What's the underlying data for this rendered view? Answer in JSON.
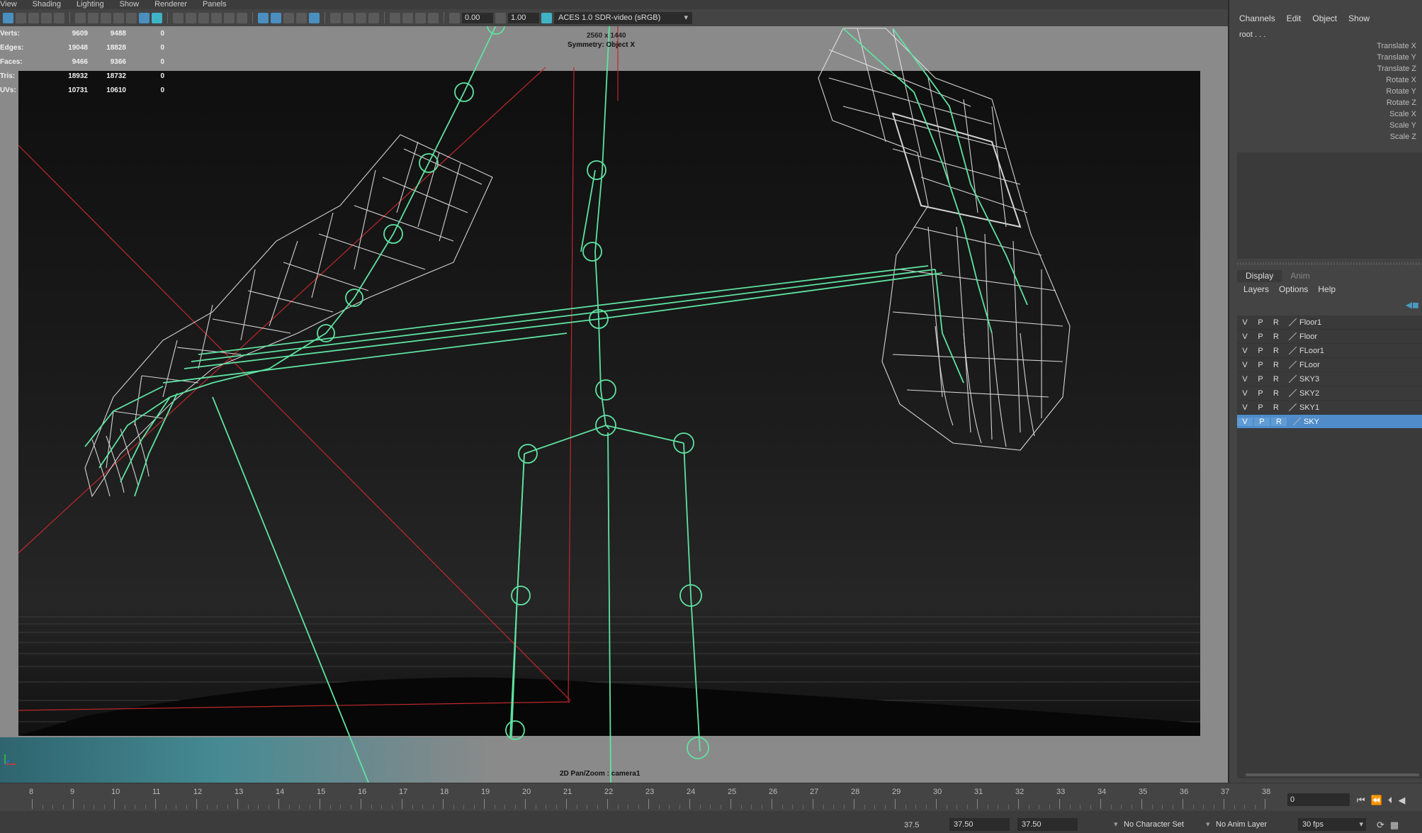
{
  "menubar": [
    "View",
    "Shading",
    "Lighting",
    "Show",
    "Renderer",
    "Panels"
  ],
  "toolbar": {
    "field_a": "0.00",
    "field_b": "1.00",
    "color_management": "ACES 1.0 SDR-video (sRGB)"
  },
  "hud": {
    "stats": [
      {
        "label": "Verts:",
        "values": [
          "9609",
          "9488",
          "0"
        ]
      },
      {
        "label": "Edges:",
        "values": [
          "19048",
          "18828",
          "0"
        ]
      },
      {
        "label": "Faces:",
        "values": [
          "9466",
          "9366",
          "0"
        ]
      },
      {
        "label": "Tris:",
        "values": [
          "18932",
          "18732",
          "0"
        ]
      },
      {
        "label": "UVs:",
        "values": [
          "10731",
          "10610",
          "0"
        ]
      }
    ],
    "resolution": "2560 x 1440",
    "symmetry": "Symmetry: Object X",
    "camera": "2D Pan/Zoom : camera1"
  },
  "channel_box": {
    "menu": [
      "Channels",
      "Edit",
      "Object",
      "Show"
    ],
    "node": "root . . .",
    "attributes": [
      "Translate X",
      "Translate Y",
      "Translate Z",
      "Rotate X",
      "Rotate Y",
      "Rotate Z",
      "Scale X",
      "Scale Y",
      "Scale Z"
    ]
  },
  "layer_editor": {
    "tabs": [
      {
        "label": "Display",
        "active": true
      },
      {
        "label": "Anim",
        "active": false
      }
    ],
    "menu": [
      "Layers",
      "Options",
      "Help"
    ],
    "layers": [
      {
        "v": "V",
        "p": "P",
        "r": "R",
        "name": "Floor1",
        "selected": false
      },
      {
        "v": "V",
        "p": "P",
        "r": "R",
        "name": "Floor",
        "selected": false
      },
      {
        "v": "V",
        "p": "P",
        "r": "R",
        "name": "FLoor1",
        "selected": false
      },
      {
        "v": "V",
        "p": "P",
        "r": "R",
        "name": "FLoor",
        "selected": false
      },
      {
        "v": "V",
        "p": "P",
        "r": "R",
        "name": "SKY3",
        "selected": false
      },
      {
        "v": "V",
        "p": "P",
        "r": "R",
        "name": "SKY2",
        "selected": false
      },
      {
        "v": "V",
        "p": "P",
        "r": "R",
        "name": "SKY1",
        "selected": false
      },
      {
        "v": "V",
        "p": "P",
        "r": "R",
        "name": "SKY",
        "selected": true
      }
    ]
  },
  "timeline": {
    "ticks": [
      "8",
      "9",
      "10",
      "11",
      "12",
      "13",
      "14",
      "15",
      "16",
      "17",
      "18",
      "19",
      "20",
      "21",
      "22",
      "23",
      "24",
      "25",
      "26",
      "27",
      "28",
      "29",
      "30",
      "31",
      "32",
      "33",
      "34",
      "35",
      "36",
      "37",
      "38"
    ],
    "current_frame": "0"
  },
  "range": {
    "start_display": "37.5",
    "start": "37.50",
    "end": "37.50",
    "character_set": "No Character Set",
    "anim_layer": "No Anim Layer",
    "fps": "30 fps"
  },
  "colors": {
    "rig": "#5fe3a1",
    "mesh": "#ffffff",
    "selected_layer": "#4f8cc9",
    "axis_red": "#c0282b"
  }
}
